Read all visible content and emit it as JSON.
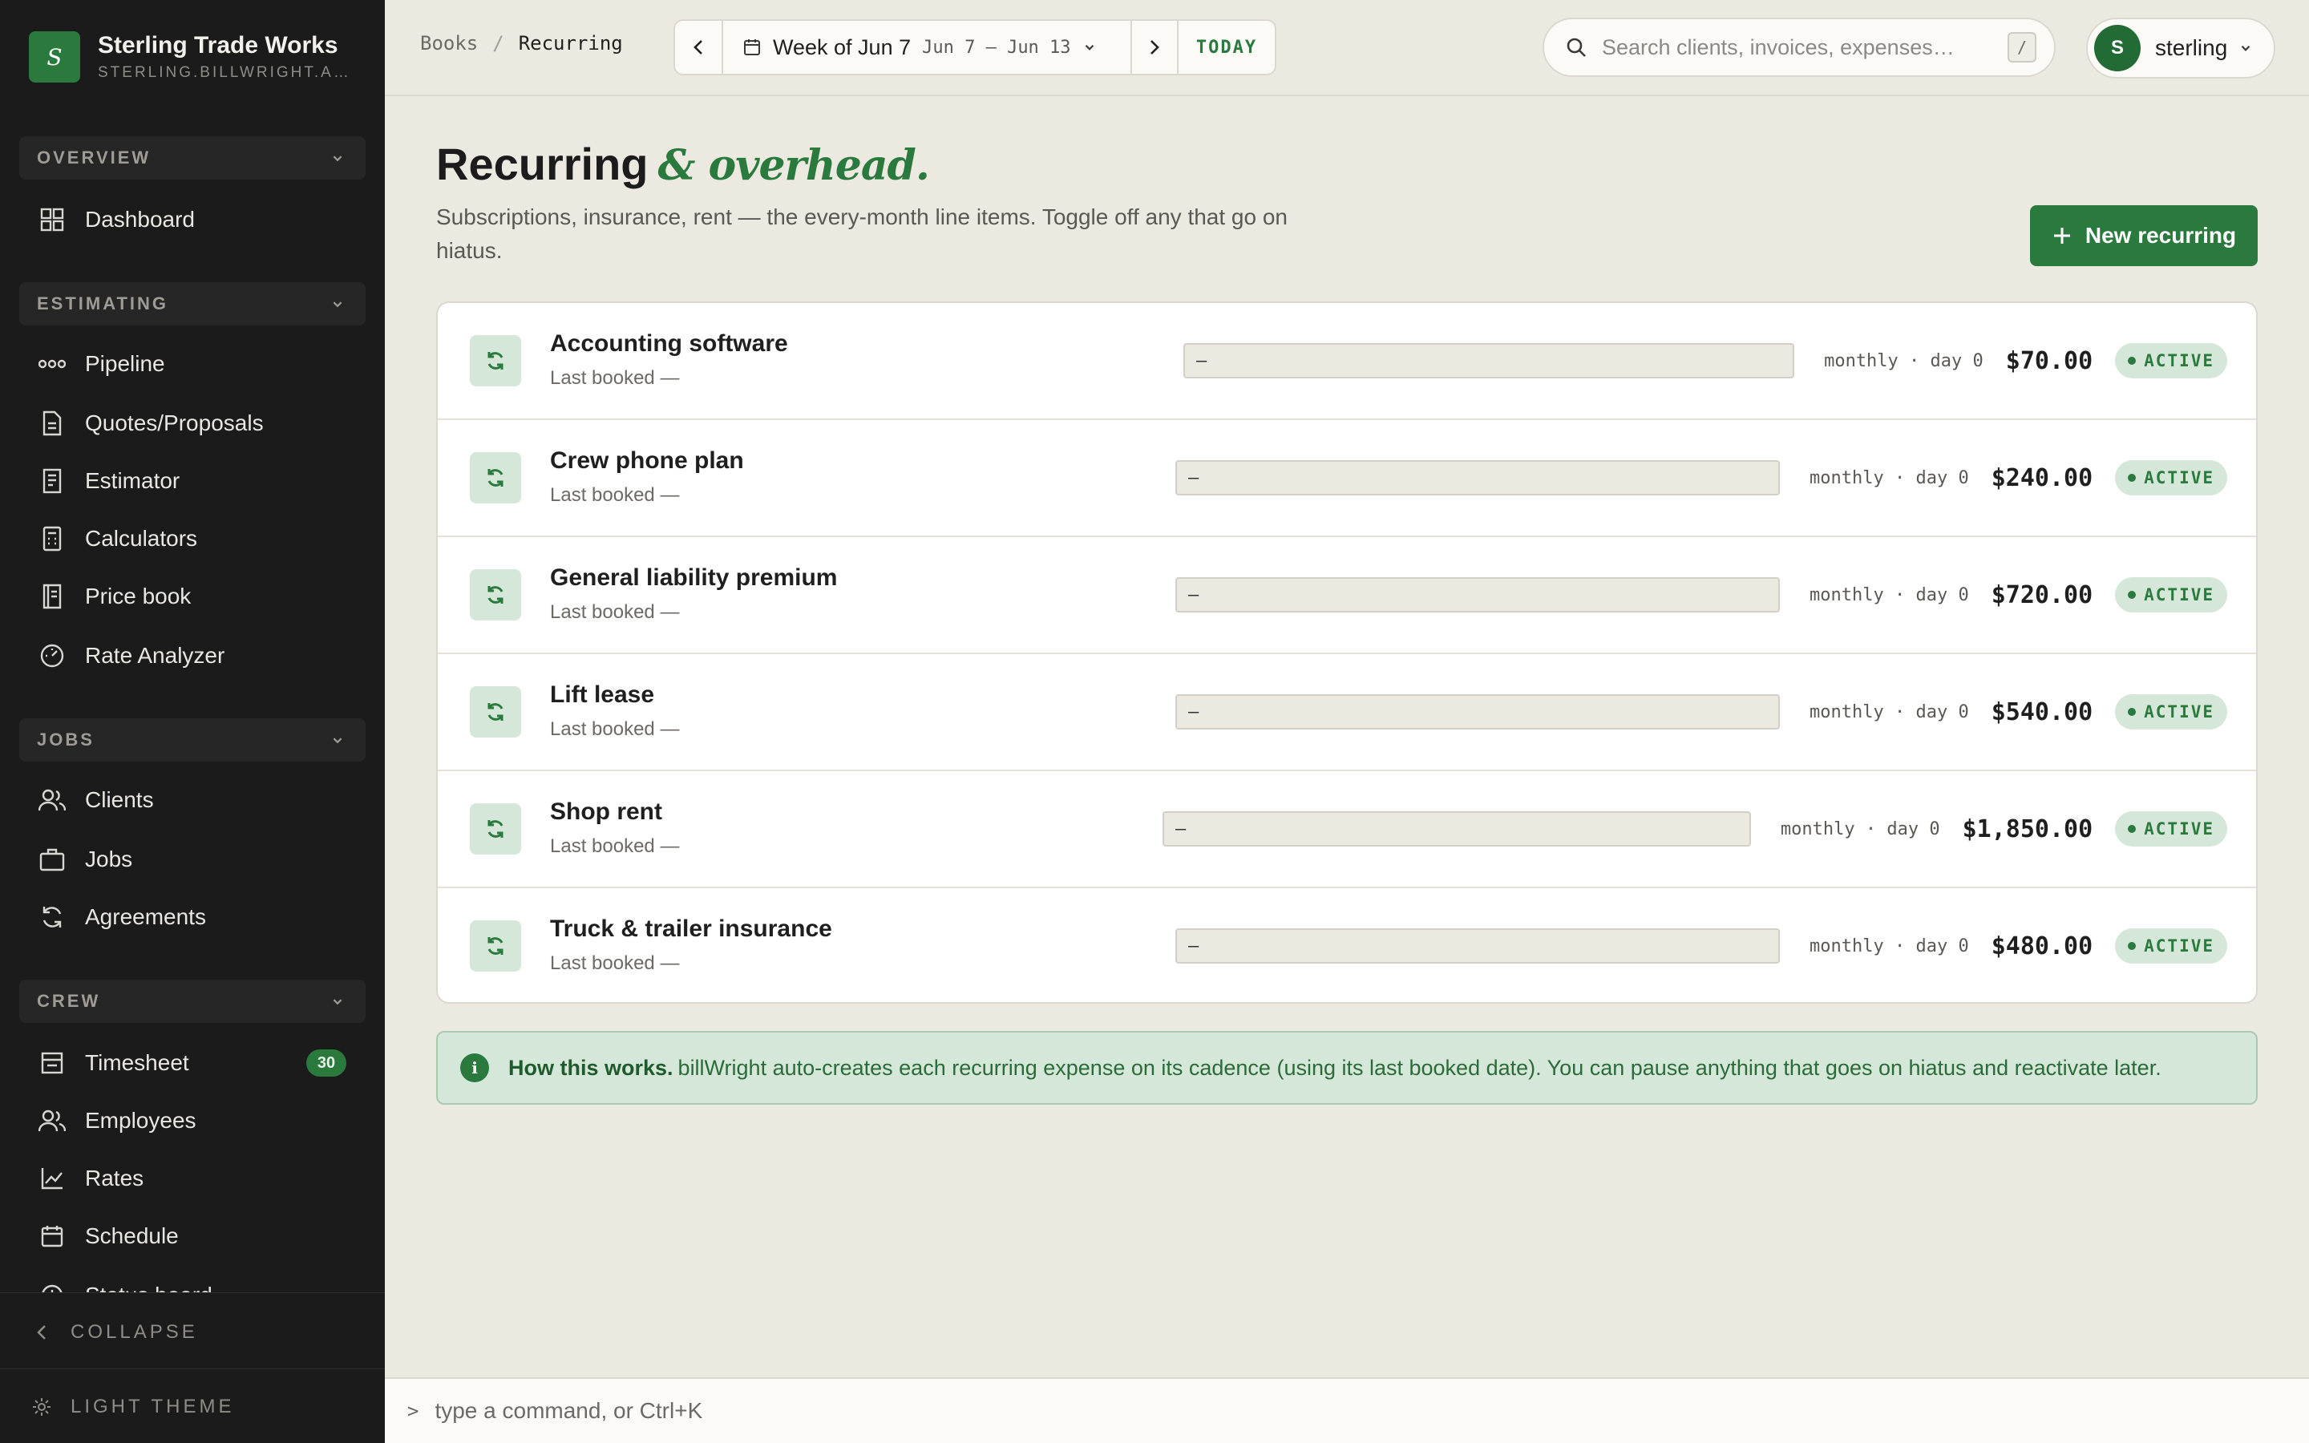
{
  "brand": {
    "logo_letter": "S",
    "name": "Sterling Trade Works",
    "subdomain": "STERLING.BILLWRIGHT.APP"
  },
  "sidebar": {
    "sections": [
      {
        "label": "OVERVIEW",
        "items": [
          {
            "label": "Dashboard",
            "icon": "grid-icon"
          }
        ]
      },
      {
        "label": "ESTIMATING",
        "items": [
          {
            "label": "Pipeline",
            "icon": "pipeline-icon"
          },
          {
            "label": "Quotes/Proposals",
            "icon": "document-icon"
          },
          {
            "label": "Estimator",
            "icon": "estimator-icon"
          },
          {
            "label": "Calculators",
            "icon": "calculator-icon"
          },
          {
            "label": "Price book",
            "icon": "price-book-icon"
          },
          {
            "label": "Rate Analyzer",
            "icon": "gauge-icon"
          }
        ]
      },
      {
        "label": "JOBS",
        "items": [
          {
            "label": "Clients",
            "icon": "users-icon"
          },
          {
            "label": "Jobs",
            "icon": "briefcase-icon"
          },
          {
            "label": "Agreements",
            "icon": "refresh-icon"
          }
        ]
      },
      {
        "label": "CREW",
        "items": [
          {
            "label": "Timesheet",
            "icon": "timesheet-icon",
            "badge": "30"
          },
          {
            "label": "Employees",
            "icon": "users-icon"
          },
          {
            "label": "Rates",
            "icon": "chart-icon"
          },
          {
            "label": "Schedule",
            "icon": "calendar-icon"
          },
          {
            "label": "Status board",
            "icon": "clock-icon"
          }
        ]
      }
    ],
    "collapse_label": "COLLAPSE",
    "theme_label": "LIGHT THEME"
  },
  "topbar": {
    "breadcrumb": [
      "Books",
      "Recurring"
    ],
    "week_title": "Week of Jun 7",
    "week_range": "Jun 7 – Jun 13",
    "today_label": "TODAY",
    "search_placeholder": "Search clients, invoices, expenses…",
    "search_shortcut": "/",
    "user_initial": "S",
    "user_name": "sterling"
  },
  "page": {
    "title": "Recurring",
    "title_accent": "& overhead.",
    "description": "Subscriptions, insurance, rent — the every-month line items. Toggle off any that go on hiatus.",
    "new_button": "New recurring"
  },
  "recurring": [
    {
      "name": "Accounting software",
      "last_booked": "Last booked —",
      "field_value": "—",
      "cadence": "monthly · day 0",
      "amount": "$70.00",
      "status": "ACTIVE"
    },
    {
      "name": "Crew phone plan",
      "last_booked": "Last booked —",
      "field_value": "—",
      "cadence": "monthly · day 0",
      "amount": "$240.00",
      "status": "ACTIVE"
    },
    {
      "name": "General liability premium",
      "last_booked": "Last booked —",
      "field_value": "—",
      "cadence": "monthly · day 0",
      "amount": "$720.00",
      "status": "ACTIVE"
    },
    {
      "name": "Lift lease",
      "last_booked": "Last booked —",
      "field_value": "—",
      "cadence": "monthly · day 0",
      "amount": "$540.00",
      "status": "ACTIVE"
    },
    {
      "name": "Shop rent",
      "last_booked": "Last booked —",
      "field_value": "—",
      "cadence": "monthly · day 0",
      "amount": "$1,850.00",
      "status": "ACTIVE"
    },
    {
      "name": "Truck & trailer insurance",
      "last_booked": "Last booked —",
      "field_value": "—",
      "cadence": "monthly · day 0",
      "amount": "$480.00",
      "status": "ACTIVE"
    }
  ],
  "info": {
    "title": "How this works.",
    "text": "billWright auto-creates each recurring expense on its cadence (using its last booked date). You can pause anything that goes on hiatus and reactivate later."
  },
  "command_bar": {
    "prompt": ">",
    "placeholder": "type a command, or Ctrl+K"
  },
  "colors": {
    "accent": "#2b7a3d",
    "sidebar_bg": "#1b1b1b",
    "page_bg": "#ece9e1",
    "status_bg": "#d5e7d8"
  }
}
